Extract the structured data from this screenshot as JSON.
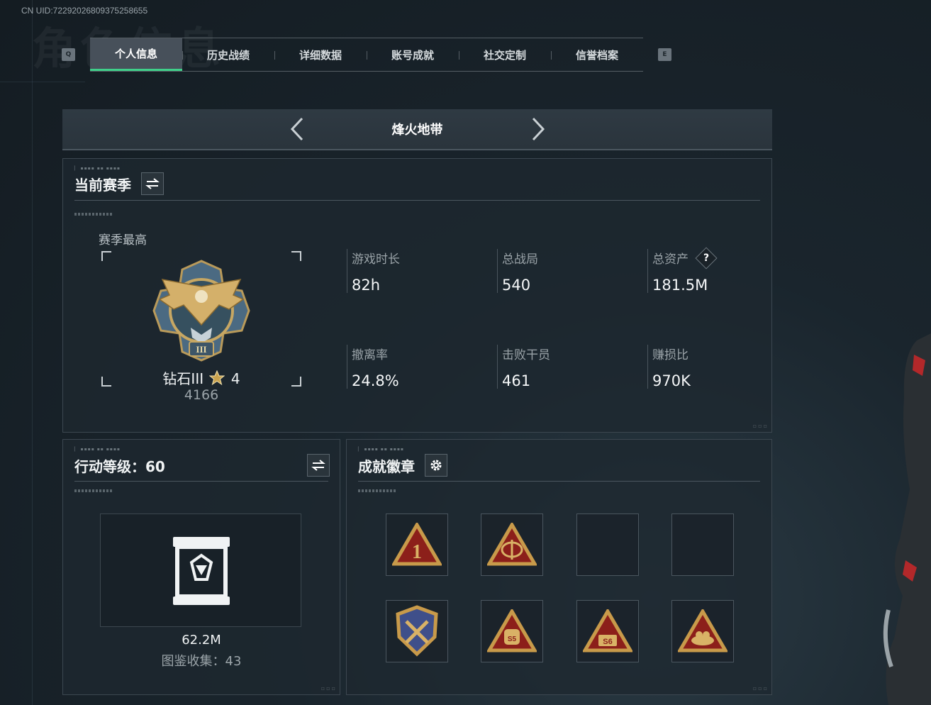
{
  "uid": "CN UID:72292026809375258655",
  "bg_title": "角色信息",
  "tabs": {
    "left_key": "Q",
    "right_key": "E",
    "items": [
      {
        "label": "个人信息",
        "active": true
      },
      {
        "label": "历史战绩",
        "active": false
      },
      {
        "label": "详细数据",
        "active": false
      },
      {
        "label": "账号成就",
        "active": false
      },
      {
        "label": "社交定制",
        "active": false
      },
      {
        "label": "信誉档案",
        "active": false
      }
    ]
  },
  "mode": {
    "name": "烽火地带"
  },
  "season": {
    "header": "当前赛季",
    "best_label": "赛季最高",
    "rank_name": "钻石III",
    "rank_stars": "4",
    "rank_score": "4166",
    "stats": [
      {
        "label": "游戏时长",
        "value": "82h"
      },
      {
        "label": "总战局",
        "value": "540"
      },
      {
        "label": "总资产",
        "value": "181.5M",
        "help": "?"
      },
      {
        "label": "撤离率",
        "value": "24.8%"
      },
      {
        "label": "击败干员",
        "value": "461"
      },
      {
        "label": "赚损比",
        "value": "970K"
      }
    ]
  },
  "level": {
    "header": "行动等级：60",
    "value": "62.2M",
    "collection": "图鉴收集：43"
  },
  "badges": {
    "header": "成就徽章",
    "items": [
      {
        "icon": "rank-1-badge-icon",
        "filled": true
      },
      {
        "icon": "globe-badge-icon",
        "filled": true
      },
      {
        "icon": "empty-slot",
        "filled": false
      },
      {
        "icon": "empty-slot",
        "filled": false
      },
      {
        "icon": "crossed-shield-badge-icon",
        "filled": true
      },
      {
        "icon": "s5-backpack-badge-icon",
        "filled": true
      },
      {
        "icon": "s6-badge-icon",
        "filled": true
      },
      {
        "icon": "nest-badge-icon",
        "filled": true
      }
    ]
  },
  "colors": {
    "accent": "#3fd08a",
    "badge_red": "#8c1f1a",
    "badge_gold": "#c89a4a"
  }
}
